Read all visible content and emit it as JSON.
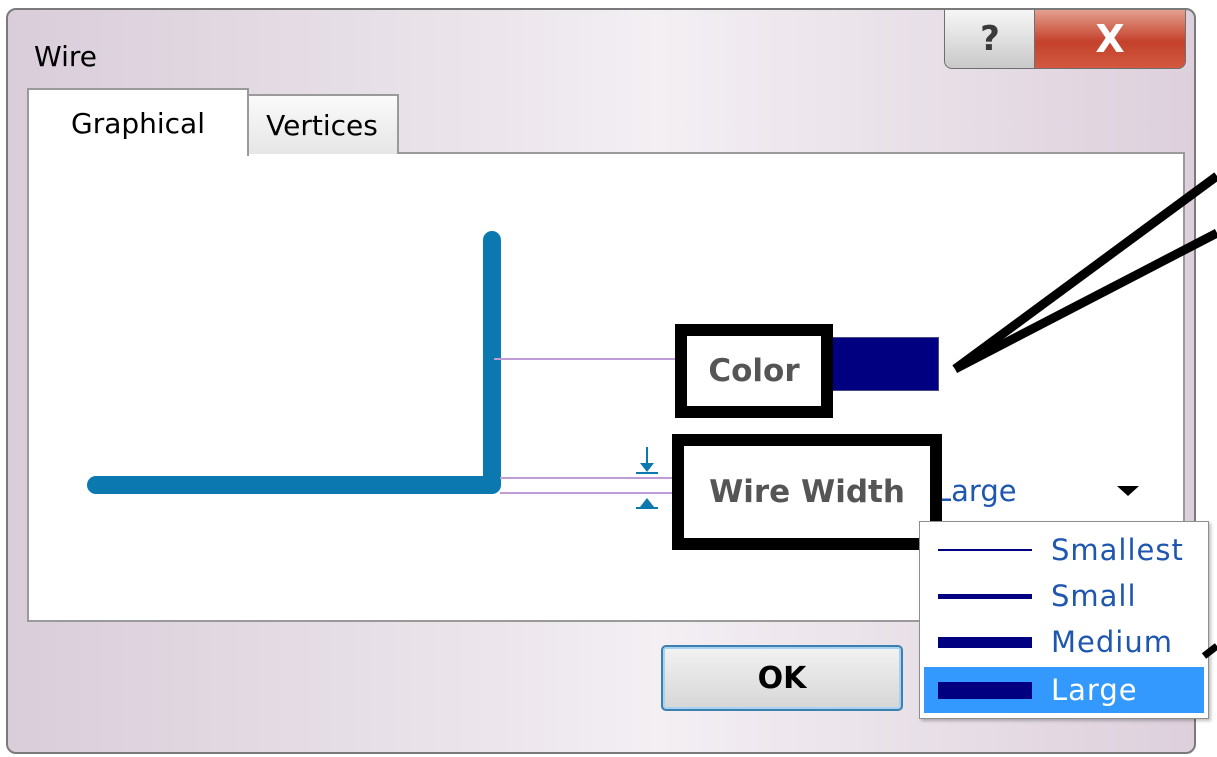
{
  "window": {
    "title": "Wire",
    "help_glyph": "?",
    "close_glyph": "X"
  },
  "tabs": [
    {
      "label": "Graphical",
      "active": true
    },
    {
      "label": "Vertices",
      "active": false
    }
  ],
  "color_setting": {
    "label": "Color",
    "value_hex": "#000080"
  },
  "width_setting": {
    "label": "Wire Width",
    "selected": "Large",
    "options": [
      "Smallest",
      "Small",
      "Medium",
      "Large"
    ]
  },
  "buttons": {
    "ok_label": "OK"
  },
  "colors": {
    "wire_preview": "#0b79b0",
    "dimension_lines": "#c09bd6",
    "selection_highlight": "#3399ff",
    "dropdown_text": "#1e56b0",
    "callout_border": "#000000"
  },
  "icons": {
    "help": "question-mark-icon",
    "close": "close-x-icon",
    "dropdown": "triangle-down-icon"
  }
}
